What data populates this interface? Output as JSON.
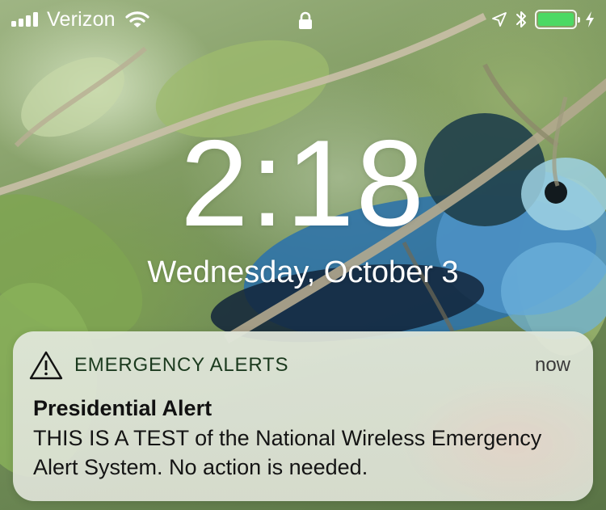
{
  "status_bar": {
    "carrier": "Verizon",
    "signal_bars": 4,
    "wifi_icon": "wifi-icon",
    "lock_icon": "lock-icon",
    "location_icon": "location-arrow-icon",
    "bluetooth_icon": "bluetooth-icon",
    "battery_icon": "battery-icon",
    "charging_icon": "charging-bolt-icon",
    "battery_level": 1.0,
    "battery_color": "#4cd964"
  },
  "lock_screen": {
    "time": "2:18",
    "date": "Wednesday, October 3"
  },
  "notification": {
    "icon": "warning-triangle-icon",
    "app_name": "EMERGENCY ALERTS",
    "time": "now",
    "title": "Presidential Alert",
    "body": "THIS IS A TEST of the National Wireless Emergency Alert System. No action is needed."
  }
}
